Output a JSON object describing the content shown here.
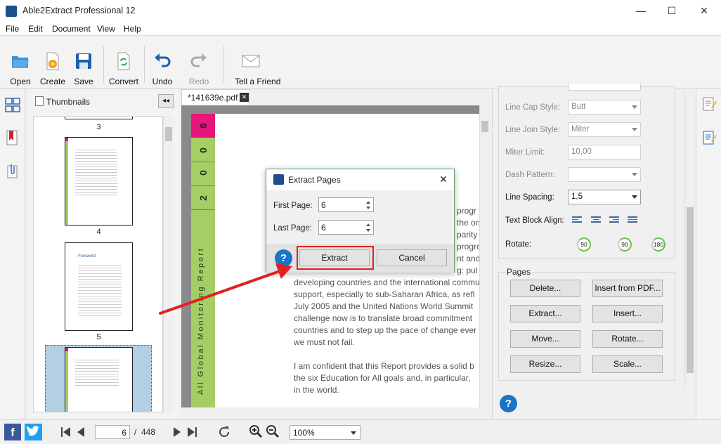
{
  "window": {
    "title": "Able2Extract Professional 12",
    "minimize": "—",
    "maximize": "☐",
    "close": "✕"
  },
  "menu": [
    "File",
    "Edit",
    "Document",
    "View",
    "Help"
  ],
  "toolbar": {
    "open": "Open",
    "create": "Create",
    "save": "Save",
    "convert": "Convert",
    "undo": "Undo",
    "redo": "Redo",
    "tell_friend": "Tell a Friend"
  },
  "thumbnails": {
    "header": "Thumbnails",
    "collapse": "◂◂",
    "page_labels": [
      "3",
      "4",
      "5"
    ],
    "foreword_text": "Foreword"
  },
  "document": {
    "tab_label": "*141639e.pdf",
    "tab_close": "✕",
    "green_digits": [
      "6",
      "0",
      "0",
      "2"
    ],
    "vertical_title": "All Global Monitoring Report",
    "lines": [
      "progr",
      "the one",
      "parity in",
      "progre",
      "nt and",
      "g: pul",
      "developing countries and the international commu",
      "support, especially to sub-Saharan Africa, as refl",
      "July 2005 and the United Nations World Summit",
      "challenge now is to translate broad commitment",
      "countries and to step up the pace of change ever",
      "we must not fail.",
      "",
      "I am confident that this Report provides a solid b",
      "the six Education for All goals and, in particular,",
      "in the world."
    ]
  },
  "properties": {
    "line_cap_label": "Line Cap Style:",
    "line_cap_value": "Butt",
    "line_join_label": "Line Join Style:",
    "line_join_value": "Miter",
    "miter_label": "Miter Limit:",
    "miter_value": "10,00",
    "dash_label": "Dash Pattern:",
    "dash_value": "",
    "spacing_label": "Line Spacing:",
    "spacing_value": "1,5",
    "align_label": "Text Block Align:",
    "rotate_label": "Rotate:",
    "rotate_values": [
      "90",
      "90",
      "180"
    ]
  },
  "pages_group": {
    "title": "Pages",
    "buttons": [
      "Delete...",
      "Insert from PDF...",
      "Extract...",
      "Insert...",
      "Move...",
      "Rotate...",
      "Resize...",
      "Scale..."
    ]
  },
  "dialog": {
    "title": "Extract Pages",
    "first_label": "First Page:",
    "first_value": "6",
    "last_label": "Last Page:",
    "last_value": "6",
    "extract": "Extract",
    "cancel": "Cancel",
    "help": "?"
  },
  "status": {
    "page_value": "6",
    "page_sep": "/",
    "page_total": "448",
    "zoom_value": "100%"
  },
  "help_label": "?",
  "colors": {
    "accent_green": "#a5cf65",
    "accent_pink": "#e8157c",
    "help_blue": "#1a75c7",
    "highlight_red": "#e22020"
  }
}
